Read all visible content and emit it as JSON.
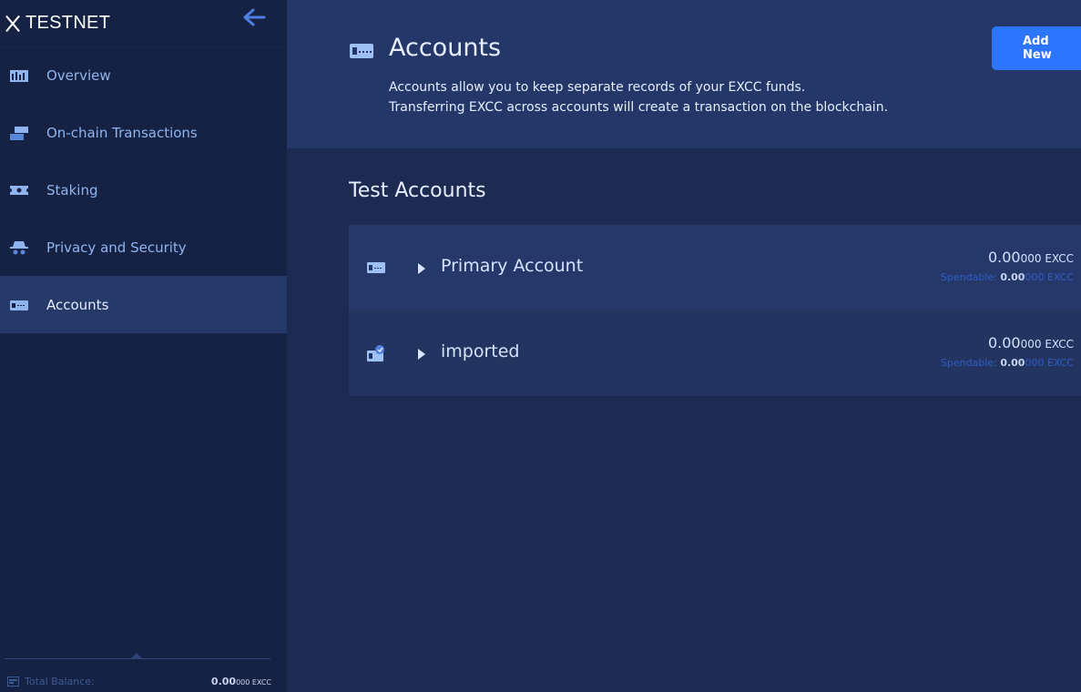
{
  "brand": {
    "title": "TESTNET"
  },
  "sidebar": {
    "items": [
      {
        "label": "Overview",
        "icon": "chart-icon"
      },
      {
        "label": "On-chain Transactions",
        "icon": "transactions-icon"
      },
      {
        "label": "Staking",
        "icon": "ticket-icon"
      },
      {
        "label": "Privacy and Security",
        "icon": "spy-icon"
      },
      {
        "label": "Accounts",
        "icon": "wallet-icon"
      }
    ],
    "active": "Accounts"
  },
  "footer": {
    "label": "Total Balance:",
    "value_int": "0.00",
    "value_dec": "000 EXCC"
  },
  "header": {
    "title": "Accounts",
    "desc_line1": "Accounts allow you to keep separate records of your EXCC funds.",
    "desc_line2": "Transferring EXCC across accounts will create a transaction on the blockchain.",
    "add_button": "Add New"
  },
  "section": {
    "title": "Test Accounts"
  },
  "accounts": [
    {
      "name": "Primary Account",
      "balance_int": "0.00",
      "balance_dec": "000 EXCC",
      "spendable_label": "Spendable:",
      "spendable_int": "0.00",
      "spendable_dec": "000 EXCC"
    },
    {
      "name": "imported",
      "balance_int": "0.00",
      "balance_dec": "000 EXCC",
      "spendable_label": "Spendable:",
      "spendable_int": "0.00",
      "spendable_dec": "000 EXCC"
    }
  ],
  "colors": {
    "sidebar_bg": "#162244",
    "main_bg": "#1d2a52",
    "header_bg": "#243768",
    "active_item_bg": "#263a6a",
    "accent_blue": "#2d74ff"
  }
}
